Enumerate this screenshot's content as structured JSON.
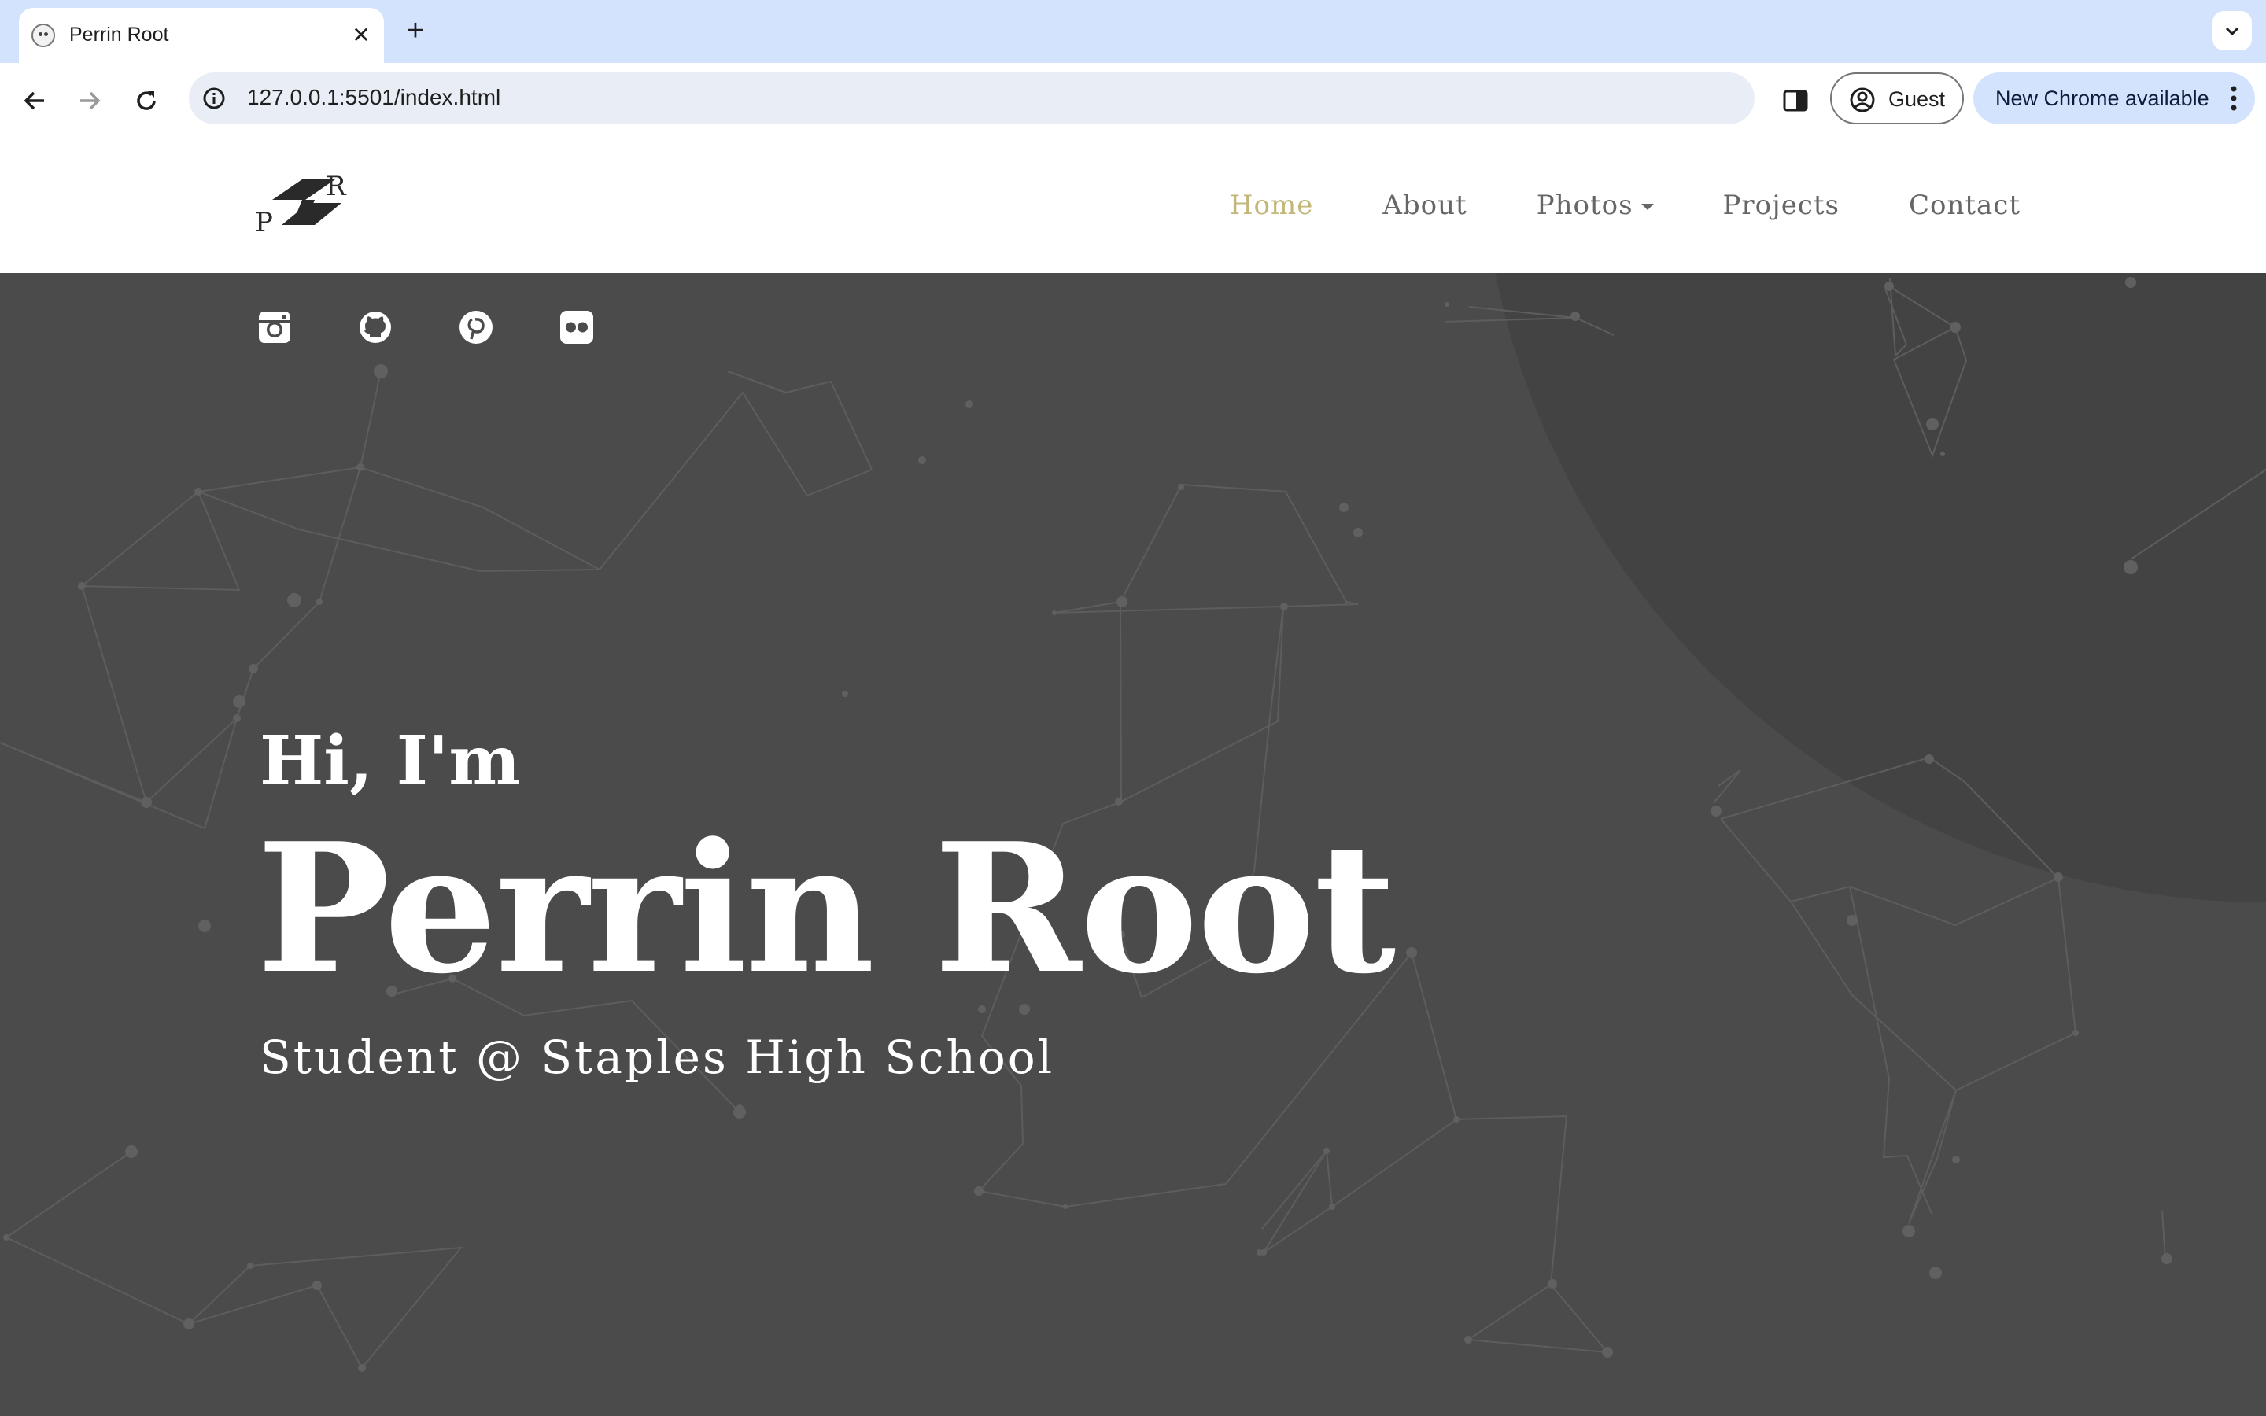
{
  "browser": {
    "tab_title": "Perrin Root",
    "url": "127.0.0.1:5501/index.html",
    "profile_label": "Guest",
    "update_label": "New Chrome available"
  },
  "site": {
    "logo_text": "PR",
    "nav": [
      {
        "label": "Home",
        "active": true
      },
      {
        "label": "About"
      },
      {
        "label": "Photos",
        "dropdown": true
      },
      {
        "label": "Projects"
      },
      {
        "label": "Contact"
      }
    ],
    "socials": [
      "instagram-icon",
      "github-icon",
      "pinterest-icon",
      "flickr-icon"
    ]
  },
  "hero": {
    "greeting": "Hi, I'm",
    "name": "Perrin Root",
    "tagline": "Student @ Staples High School"
  },
  "colors": {
    "hero_bg": "#4b4b4b",
    "nav_active": "#c2b778",
    "nav_text": "#666666"
  }
}
